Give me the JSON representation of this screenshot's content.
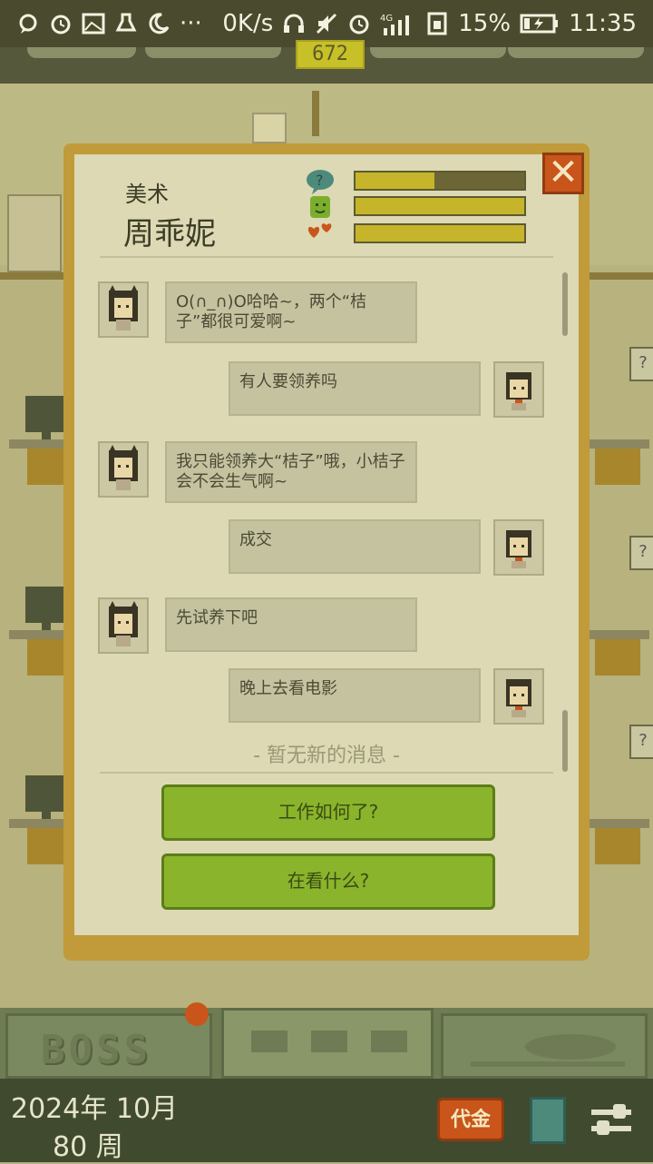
{
  "status_bar": {
    "network_speed": "0K/s",
    "signal_label": "4G",
    "battery": "15%",
    "time": "11:35",
    "overflow": "···"
  },
  "hud": {
    "counter": "672"
  },
  "employee": {
    "department": "美术",
    "name": "周乖妮",
    "stats": [
      {
        "icon": "question-bubble-icon",
        "level": 0.47
      },
      {
        "icon": "green-face-icon",
        "level": 1.0
      },
      {
        "icon": "hearts-icon",
        "level": 1.0
      }
    ]
  },
  "chat": {
    "messages": [
      {
        "from": "employee",
        "text": "O(∩_∩)O哈哈~，两个“桔子”都很可爱啊~"
      },
      {
        "from": "boss",
        "text": "有人要领养吗"
      },
      {
        "from": "employee",
        "text": "我只能领养大“桔子”哦，小桔子会不会生气啊~"
      },
      {
        "from": "boss",
        "text": "成交"
      },
      {
        "from": "employee",
        "text": "先试养下吧"
      },
      {
        "from": "boss",
        "text": "晚上去看电影"
      }
    ],
    "no_new": "- 暂无新的消息 -"
  },
  "actions": {
    "btn1": "工作如何了?",
    "btn2": "在看什么?"
  },
  "bottom": {
    "boss_tab": "BOSS",
    "date_line1": "2024年 10月",
    "date_line2": "80 周",
    "money_btn": "代金"
  },
  "colors": {
    "accent_green": "#8ab42b",
    "accent_orange": "#c9551a",
    "bar_fill": "#c6b42a"
  }
}
